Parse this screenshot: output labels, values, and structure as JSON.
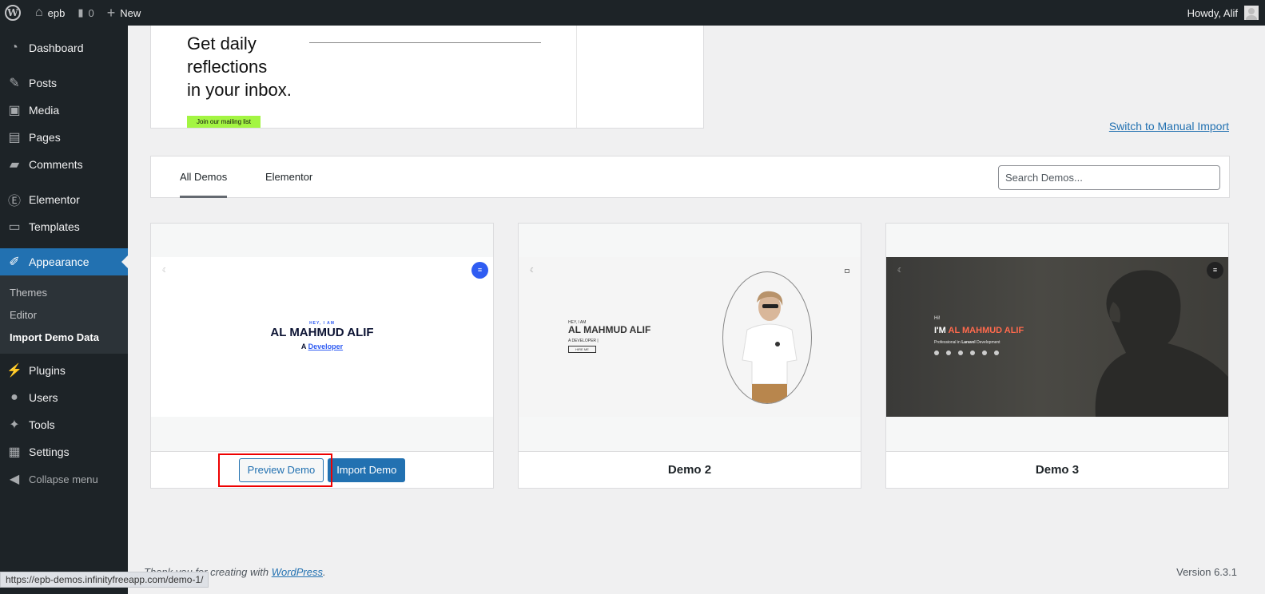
{
  "adminbar": {
    "site_name": "epb",
    "comments_count": "0",
    "new_label": "New",
    "howdy": "Howdy, Alif"
  },
  "sidebar": {
    "items": [
      {
        "label": "Dashboard",
        "icon": "dashboard-icon"
      },
      {
        "label": "Posts",
        "icon": "pin-icon"
      },
      {
        "label": "Media",
        "icon": "media-icon"
      },
      {
        "label": "Pages",
        "icon": "pages-icon"
      },
      {
        "label": "Comments",
        "icon": "comments-icon"
      },
      {
        "label": "Elementor",
        "icon": "elementor-icon"
      },
      {
        "label": "Templates",
        "icon": "folder-icon"
      },
      {
        "label": "Appearance",
        "icon": "brush-icon"
      },
      {
        "label": "Plugins",
        "icon": "plug-icon"
      },
      {
        "label": "Users",
        "icon": "user-icon"
      },
      {
        "label": "Tools",
        "icon": "wrench-icon"
      },
      {
        "label": "Settings",
        "icon": "settings-icon"
      }
    ],
    "submenu": [
      "Themes",
      "Editor",
      "Import Demo Data"
    ],
    "collapse_label": "Collapse menu"
  },
  "preview_top": {
    "headline_lines": [
      "Get daily",
      "reflections",
      "in your inbox."
    ],
    "mailing_button": "Join our mailing list"
  },
  "manual_import_link": "Switch to Manual Import",
  "tabs": [
    "All Demos",
    "Elementor"
  ],
  "search": {
    "placeholder": "Search Demos...",
    "value": ""
  },
  "demos": [
    {
      "hey": "HEY, I AM",
      "name": "AL MAHMUD ALIF",
      "role_prefix": "A",
      "role_highlight": "Developer",
      "preview_button": "Preview Demo",
      "import_button": "Import Demo"
    },
    {
      "title": "Demo 2",
      "hey": "HEY, I AM",
      "name": "AL MAHMUD ALIF",
      "role": "A DEVELOPER |",
      "hire": "HIRE ME"
    },
    {
      "title": "Demo 3",
      "hi": "Hi!",
      "name_prefix": "I'M",
      "name_highlight": "AL MAHMUD ALIF",
      "role_prefix": "Professional in",
      "role_bold": "Laravel",
      "role_suffix": "Development"
    }
  ],
  "footer": {
    "thanks_prefix": "Thank you for creating with",
    "thanks_link": "WordPress",
    "thanks_suffix": ".",
    "version": "Version 6.3.1"
  },
  "status_url": "https://epb-demos.infinityfreeapp.com/demo-1/",
  "colors": {
    "wp_dark": "#1d2327",
    "wp_blue": "#2271b1",
    "highlight_red": "#e00000",
    "demo1_accent": "#2f5cf2",
    "demo3_accent": "#ff6a4d",
    "mailing_green": "#a3f542"
  }
}
